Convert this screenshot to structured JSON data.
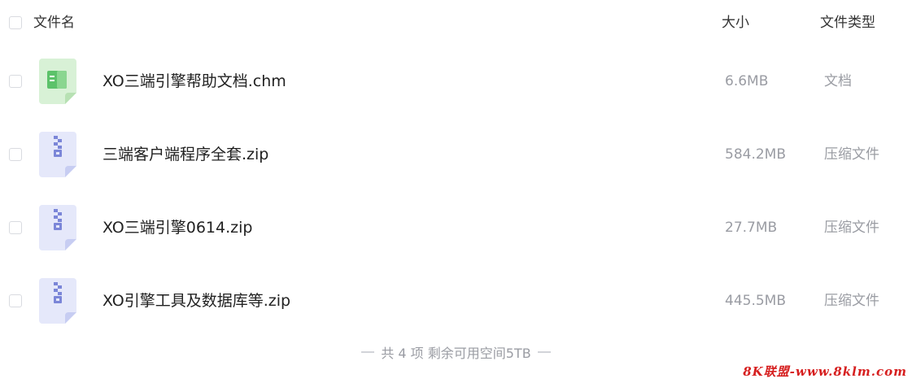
{
  "header": {
    "name_label": "文件名",
    "size_label": "大小",
    "type_label": "文件类型"
  },
  "files": [
    {
      "name": "XO三端引擎帮助文档.chm",
      "size": "6.6MB",
      "type": "文档",
      "icon": "document-icon",
      "color": "#5cc26a"
    },
    {
      "name": "三端客户端程序全套.zip",
      "size": "584.2MB",
      "type": "压缩文件",
      "icon": "zip-icon",
      "color": "#7b86d8"
    },
    {
      "name": "XO三端引擎0614.zip",
      "size": "27.7MB",
      "type": "压缩文件",
      "icon": "zip-icon",
      "color": "#7b86d8"
    },
    {
      "name": "XO引擎工具及数据库等.zip",
      "size": "445.5MB",
      "type": "压缩文件",
      "icon": "zip-icon",
      "color": "#7b86d8"
    }
  ],
  "footer": {
    "summary": "共 4 项 剩余可用空间5TB"
  },
  "watermark": {
    "text": "8K联盟-www.8klm.com"
  }
}
